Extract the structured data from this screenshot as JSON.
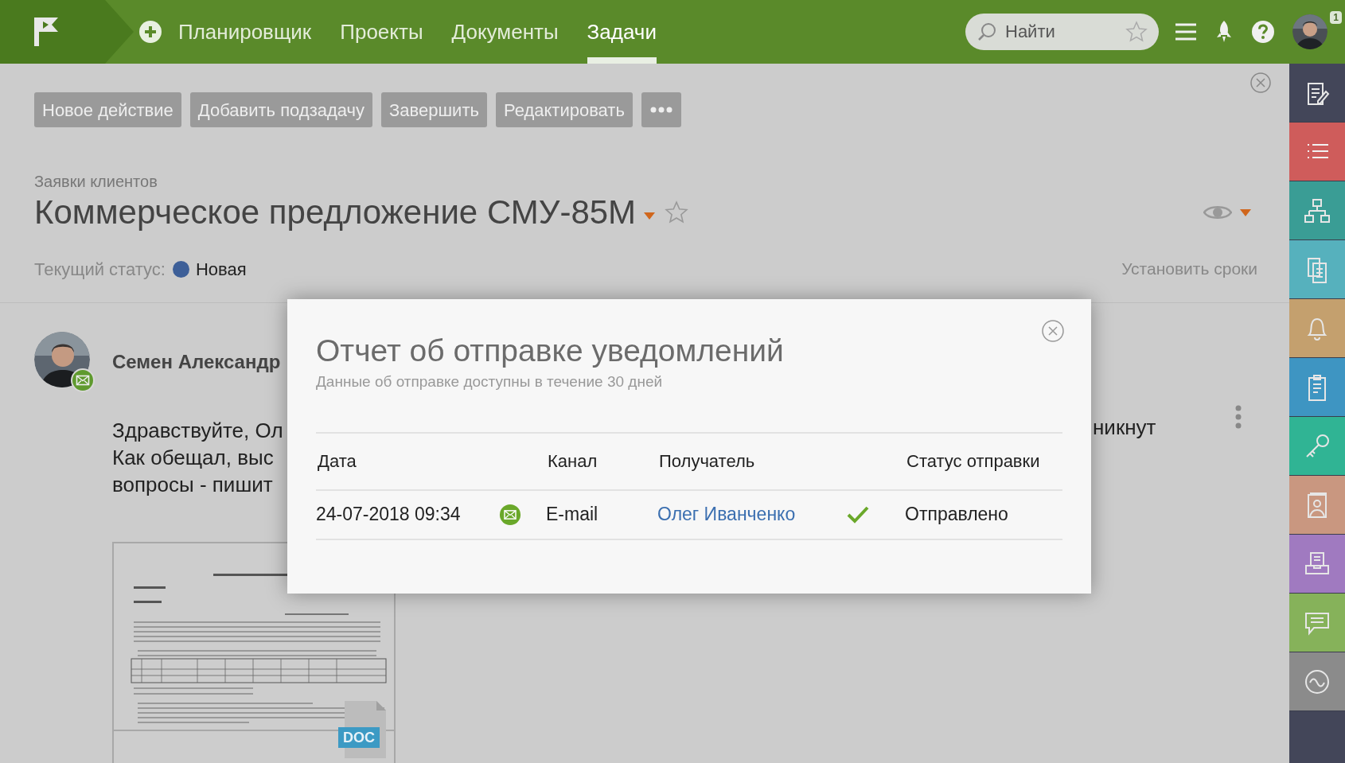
{
  "top_nav": {
    "items": [
      {
        "label": "Планировщик",
        "selected": false
      },
      {
        "label": "Проекты",
        "selected": false
      },
      {
        "label": "Документы",
        "selected": false
      },
      {
        "label": "Задачи",
        "selected": true
      }
    ],
    "search": {
      "placeholder": "Найти"
    },
    "notification_count": "1"
  },
  "toolbar": {
    "buttons": [
      "Новое действие",
      "Добавить подзадачу",
      "Завершить",
      "Редактировать"
    ]
  },
  "task": {
    "category": "Заявки клиентов",
    "title": "Коммерческое предложение СМУ-85М",
    "status_label": "Текущий статус:",
    "status": {
      "text": "Новая",
      "color": "#3d5f98"
    },
    "set_deadlines": "Установить сроки"
  },
  "comment": {
    "author": "Семен Александр",
    "lines": [
      "Здравствуйте, Ол",
      "Как обещал, выс",
      "вопросы - пишит"
    ],
    "right_fragment": "никнут",
    "attachment": {
      "type_label": "DOC"
    }
  },
  "modal": {
    "title": "Отчет об отправке уведомлений",
    "subtitle": "Данные об отправке доступны в течение 30 дней",
    "columns": [
      "Дата",
      "Канал",
      "Получатель",
      "Статус отправки"
    ],
    "rows": [
      {
        "date": "24-07-2018 09:34",
        "channel": "E-mail",
        "recipient": "Олег Иванченко",
        "status": "Отправлено",
        "delivered": true
      }
    ]
  },
  "sidebar": {
    "items": [
      {
        "kind": "edit",
        "color": "#434659"
      },
      {
        "kind": "list",
        "color": "#cf5c5b"
      },
      {
        "kind": "hierarchy",
        "color": "#3a9d95"
      },
      {
        "kind": "documents",
        "color": "#56b1bd"
      },
      {
        "kind": "bell",
        "color": "#c4a06e"
      },
      {
        "kind": "clipboard",
        "color": "#3e95c2"
      },
      {
        "kind": "key",
        "color": "#30b494"
      },
      {
        "kind": "contacts",
        "color": "#c99780"
      },
      {
        "kind": "inbox",
        "color": "#a07ac0"
      },
      {
        "kind": "chat",
        "color": "#86b25a"
      },
      {
        "kind": "wave",
        "color": "#8b8b8b"
      }
    ]
  }
}
